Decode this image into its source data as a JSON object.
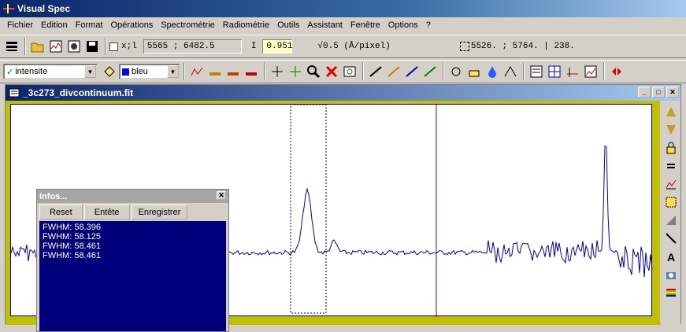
{
  "app": {
    "title": "Visual Spec"
  },
  "menu": [
    "Fichier",
    "Edition",
    "Format",
    "Opérations",
    "Spectrométrie",
    "Radiométrie",
    "Outils",
    "Assistant",
    "Fenêtre",
    "Options",
    "?"
  ],
  "toolbar1": {
    "coord_label": "x;l",
    "coord_value": "5565 ; 6482.5",
    "i_label": "I",
    "i_value": "0.951",
    "dispersion": "√0.5 (Å/pixel)",
    "selection": "5526. ; 5764. |  238."
  },
  "toolbar2": {
    "mode_select": "intensite",
    "color_select": "bleu",
    "colors": {
      "swatch": "#0000ff"
    }
  },
  "child": {
    "title": "_3c273_divcontinuum.fit",
    "colors": {
      "plot_bg": "#ffffff",
      "frame": "#c0c000",
      "curve": "#0000c0",
      "marker": "#a00000"
    }
  },
  "infos": {
    "title": "Infos...",
    "buttons": {
      "reset": "Reset",
      "entete": "Entête",
      "enregistrer": "Enregistrer"
    },
    "lines": [
      "FWHM:  58.396",
      "FWHM:  58.125",
      "FWHM:  58.461",
      "FWHM:  58.461"
    ]
  }
}
